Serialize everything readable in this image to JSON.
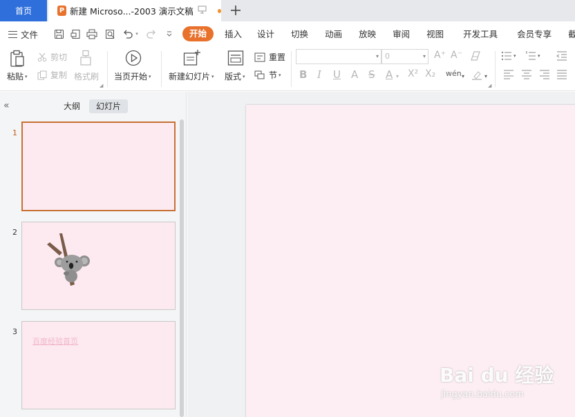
{
  "titlebar": {
    "home_tab": "首页",
    "doc_tab": "新建 Microso...-2003 演示文稿",
    "doc_icon_letter": "P",
    "add_tab_icon": "plus-icon"
  },
  "menubar": {
    "file_label": "文件",
    "tabs": [
      "开始",
      "插入",
      "设计",
      "切换",
      "动画",
      "放映",
      "审阅",
      "视图",
      "开发工具",
      "会员专享",
      "截"
    ],
    "active_tab": "开始"
  },
  "ribbon": {
    "paste": "粘贴",
    "cut": "剪切",
    "copy": "复制",
    "format_painter": "格式刷",
    "play_from_current": "当页开始",
    "new_slide": "新建幻灯片",
    "layout": "版式",
    "reset": "重置",
    "section": "节",
    "font_name": "",
    "font_size": "0",
    "grow_font": "A⁺",
    "shrink_font": "A⁻"
  },
  "leftpane": {
    "tab_outline": "大纲",
    "tab_slides": "幻灯片",
    "active_tab": "幻灯片",
    "slides": [
      {
        "number": "1",
        "text": ""
      },
      {
        "number": "2",
        "text": ""
      },
      {
        "number": "3",
        "text": "百度经验首页"
      }
    ]
  },
  "watermark": {
    "main": "Bai du 经验",
    "sub": "jingyan.baidu.com"
  },
  "colors": {
    "accent": "#e8712c",
    "home_tab": "#2f6fdc",
    "slide_bg": "#fdeef4"
  }
}
